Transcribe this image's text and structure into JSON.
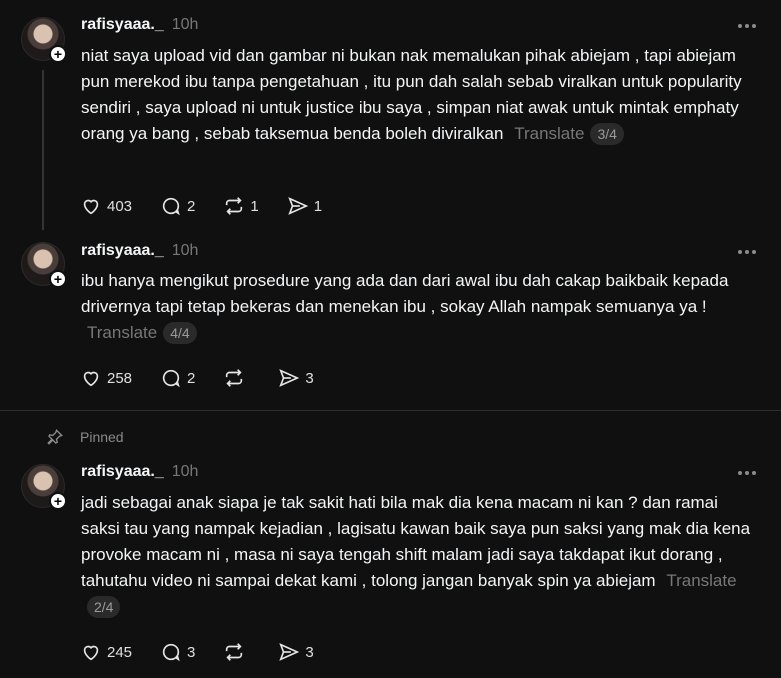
{
  "posts": [
    {
      "username": "rafisyaaa._",
      "time": "10h",
      "text": "niat saya upload vid dan gambar ni bukan nak memalukan pihak abiejam , tapi abiejam pun merekod ibu tanpa pengetahuan , itu pun dah salah sebab viralkan untuk popularity sendiri , saya upload ni untuk justice ibu saya , simpan niat awak untuk mintak emphaty orang ya bang , sebab taksemua benda boleh diviralkan",
      "translate": "Translate",
      "page": "3/4",
      "likes": "403",
      "replies": "2",
      "reposts": "1",
      "shares": "1"
    },
    {
      "username": "rafisyaaa._",
      "time": "10h",
      "text": "ibu hanya mengikut prosedure yang ada dan dari awal ibu dah cakap baikbaik kepada drivernya tapi tetap bekeras dan menekan ibu , sokay Allah nampak semuanya ya !",
      "translate": "Translate",
      "page": "4/4",
      "likes": "258",
      "replies": "2",
      "reposts": "",
      "shares": "3"
    },
    {
      "username": "rafisyaaa._",
      "time": "10h",
      "text": "jadi sebagai anak siapa je tak sakit hati bila mak dia kena macam ni kan ? dan ramai saksi tau yang nampak kejadian , lagisatu kawan baik saya pun saksi yang mak dia kena provoke macam ni , masa ni saya tengah shift malam jadi saya takdapat ikut dorang , tahutahu video ni sampai dekat kami , tolong jangan banyak spin ya abiejam",
      "translate": "Translate",
      "page": "2/4",
      "likes": "245",
      "replies": "3",
      "reposts": "",
      "shares": "3"
    }
  ],
  "pinned_label": "Pinned",
  "icons": {
    "like": "heart-icon",
    "reply": "comment-icon",
    "repost": "repost-icon",
    "share": "share-icon",
    "more": "more-icon",
    "pin": "pin-icon",
    "follow": "plus-icon"
  }
}
